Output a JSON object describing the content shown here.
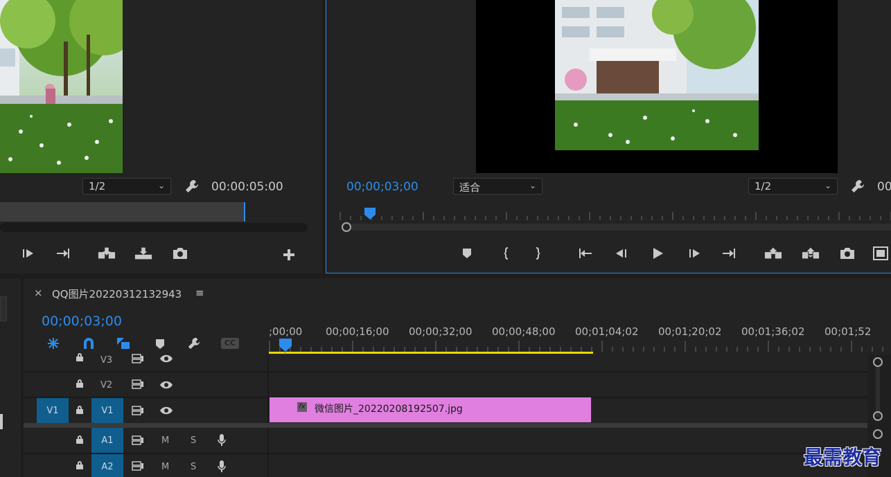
{
  "source_monitor": {
    "zoom_value": "1/2",
    "duration": "00:00:05:00"
  },
  "program_monitor": {
    "playhead_time": "00;00;03;00",
    "fit_value": "适合",
    "zoom_value": "1/2",
    "duration_partial": "00"
  },
  "timeline": {
    "sequence_name": "QQ图片20220312132943",
    "playhead_time": "00;00;03;00",
    "ruler_labels": [
      ";00;00",
      "00;00;16;00",
      "00;00;32;00",
      "00;00;48;00",
      "00;01;04;02",
      "00;01;20;02",
      "00;01;36;02",
      "00;01;52"
    ],
    "tracks": {
      "v3": "V3",
      "v2": "V2",
      "v1_target": "V1",
      "v1": "V1",
      "a1": "A1",
      "a2": "A2",
      "mute": "M",
      "solo": "S"
    },
    "clip_name": "微信图片_20220208192507.jpg",
    "clip_fx": "fx",
    "clip_color": "#e07fe0",
    "caption_label": "CC"
  },
  "watermark": "最需教育",
  "colors": {
    "accent_blue": "#2d8ceb",
    "work_area_yellow": "#e8d800",
    "track_target": "#0f5e8e"
  }
}
